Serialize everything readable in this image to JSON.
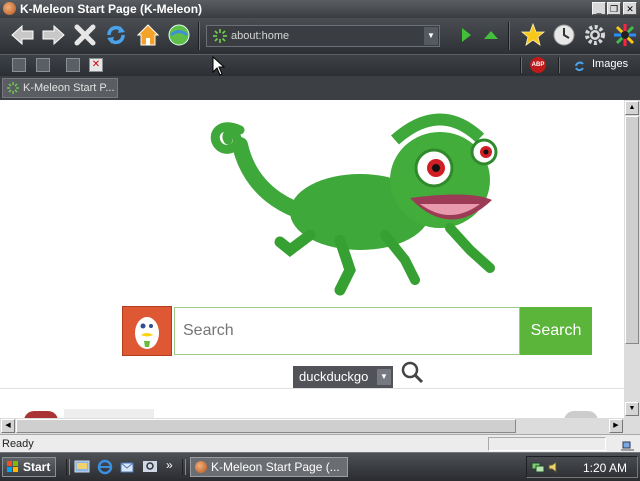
{
  "window": {
    "title": "K-Meleon Start Page (K-Meleon)"
  },
  "toolbar": {
    "buttons": [
      "back-icon",
      "forward-icon",
      "stop-icon",
      "reload-icon",
      "home-icon",
      "browse-icon"
    ],
    "url": "about:home",
    "right_buttons": [
      "go-icon",
      "up-icon",
      "bookmarks-star-icon",
      "history-clock-icon",
      "settings-gear-icon",
      "k-meleon-logo-icon"
    ]
  },
  "secondary_toolbar": {
    "abp_label": "ABP",
    "images_label": "Images"
  },
  "tabs": [
    {
      "label": "K-Meleon Start P..."
    }
  ],
  "page": {
    "search": {
      "placeholder": "Search",
      "button_label": "Search"
    },
    "engine": {
      "selected": "duckduckgo"
    }
  },
  "status": {
    "text": "Ready"
  },
  "taskbar": {
    "start_label": "Start",
    "task_label": "K-Meleon Start Page (...",
    "clock": "1:20 AM",
    "chevron": "»"
  },
  "colors": {
    "accent_green": "#5ab53a",
    "ddg_orange": "#de5833",
    "chameleon_green": "#3fa83a"
  }
}
